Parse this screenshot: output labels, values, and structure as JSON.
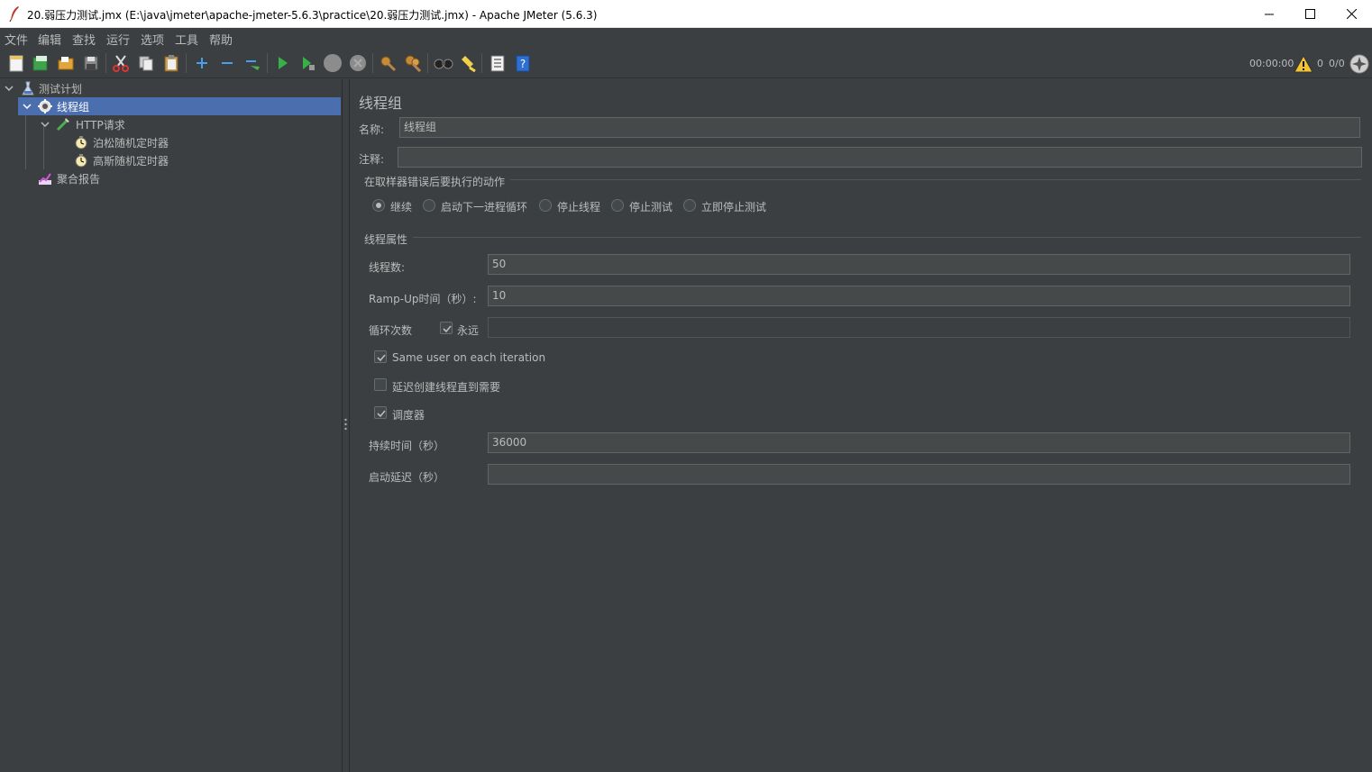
{
  "window": {
    "title": "20.弱压力测试.jmx (E:\\java\\jmeter\\apache-jmeter-5.6.3\\practice\\20.弱压力测试.jmx) - Apache JMeter (5.6.3)",
    "minimize_icon": "minimize-icon",
    "maximize_icon": "maximize-icon",
    "close_icon": "close-icon"
  },
  "menu": [
    "文件",
    "编辑",
    "查找",
    "运行",
    "选项",
    "工具",
    "帮助"
  ],
  "toolbar": {
    "icons": [
      "new-icon",
      "templates-icon",
      "open-icon",
      "save-icon",
      "cut-icon",
      "copy-icon",
      "paste-icon",
      "expand-icon",
      "collapse-icon",
      "toggle-icon",
      "start-icon",
      "start-no-pause-icon",
      "stop-icon",
      "shutdown-icon",
      "clear-icon",
      "clear-all-icon",
      "search-icon",
      "reset-search-icon",
      "function-helper-icon",
      "help-icon"
    ],
    "timer": "00:00:00",
    "warning_count": "0",
    "threads": "0/0"
  },
  "tree": {
    "items": [
      {
        "label": "测试计划",
        "icon": "test-plan-icon"
      },
      {
        "label": "线程组",
        "icon": "thread-group-icon"
      },
      {
        "label": "HTTP请求",
        "icon": "sampler-icon"
      },
      {
        "label": "泊松随机定时器",
        "icon": "timer-icon"
      },
      {
        "label": "高斯随机定时器",
        "icon": "timer-icon"
      },
      {
        "label": "聚合报告",
        "icon": "report-icon"
      }
    ]
  },
  "panel": {
    "heading": "线程组",
    "name_label": "名称:",
    "name_value": "线程组",
    "comment_label": "注释:",
    "comment_value": "",
    "error_action_title": "在取样器错误后要执行的动作",
    "error_actions": [
      "继续",
      "启动下一进程循环",
      "停止线程",
      "停止测试",
      "立即停止测试"
    ],
    "selected_error_action": "继续",
    "thread_props_title": "线程属性",
    "threads_label": "线程数:",
    "threads_value": "50",
    "rampup_label": "Ramp-Up时间（秒）:",
    "rampup_value": "10",
    "loop_label": "循环次数",
    "forever_label": "永远",
    "forever_checked": true,
    "loop_value": "",
    "same_user_label": "Same user on each iteration",
    "same_user_checked": true,
    "delay_label": "延迟创建线程直到需要",
    "delay_checked": false,
    "scheduler_label": "调度器",
    "scheduler_checked": true,
    "duration_label": "持续时间（秒）",
    "duration_value": "36000",
    "startup_delay_label": "启动延迟（秒）",
    "startup_delay_value": ""
  },
  "colors": {
    "background": "#3c3f41",
    "selection": "#4b6eaf",
    "text": "#bbbbbb",
    "field": "#45494a"
  }
}
